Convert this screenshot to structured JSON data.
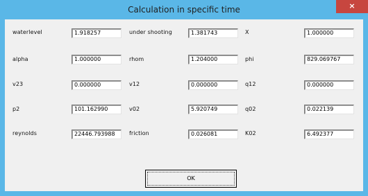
{
  "window": {
    "title": "Calculation in specific time",
    "close_label": "×"
  },
  "rows": [
    [
      {
        "label": "waterlevel",
        "value": "1.918257"
      },
      {
        "label": "under shooting",
        "value": "1.381743"
      },
      {
        "label": "X",
        "value": "1.000000"
      }
    ],
    [
      {
        "label": "alpha",
        "value": "1.000000"
      },
      {
        "label": "rhom",
        "value": "1.204000"
      },
      {
        "label": "phi",
        "value": "829.069767"
      }
    ],
    [
      {
        "label": "v23",
        "value": "0.000000"
      },
      {
        "label": "v12",
        "value": "0.000000"
      },
      {
        "label": "q12",
        "value": "0.000000"
      }
    ],
    [
      {
        "label": "p2",
        "value": "101.162990"
      },
      {
        "label": "v02",
        "value": "5.920749"
      },
      {
        "label": "q02",
        "value": "0.022139"
      }
    ],
    [
      {
        "label": "reynolds",
        "value": "22446.793988"
      },
      {
        "label": "friction",
        "value": "0.026081"
      },
      {
        "label": "K02",
        "value": "6.492377"
      }
    ]
  ],
  "ok_label": "OK"
}
